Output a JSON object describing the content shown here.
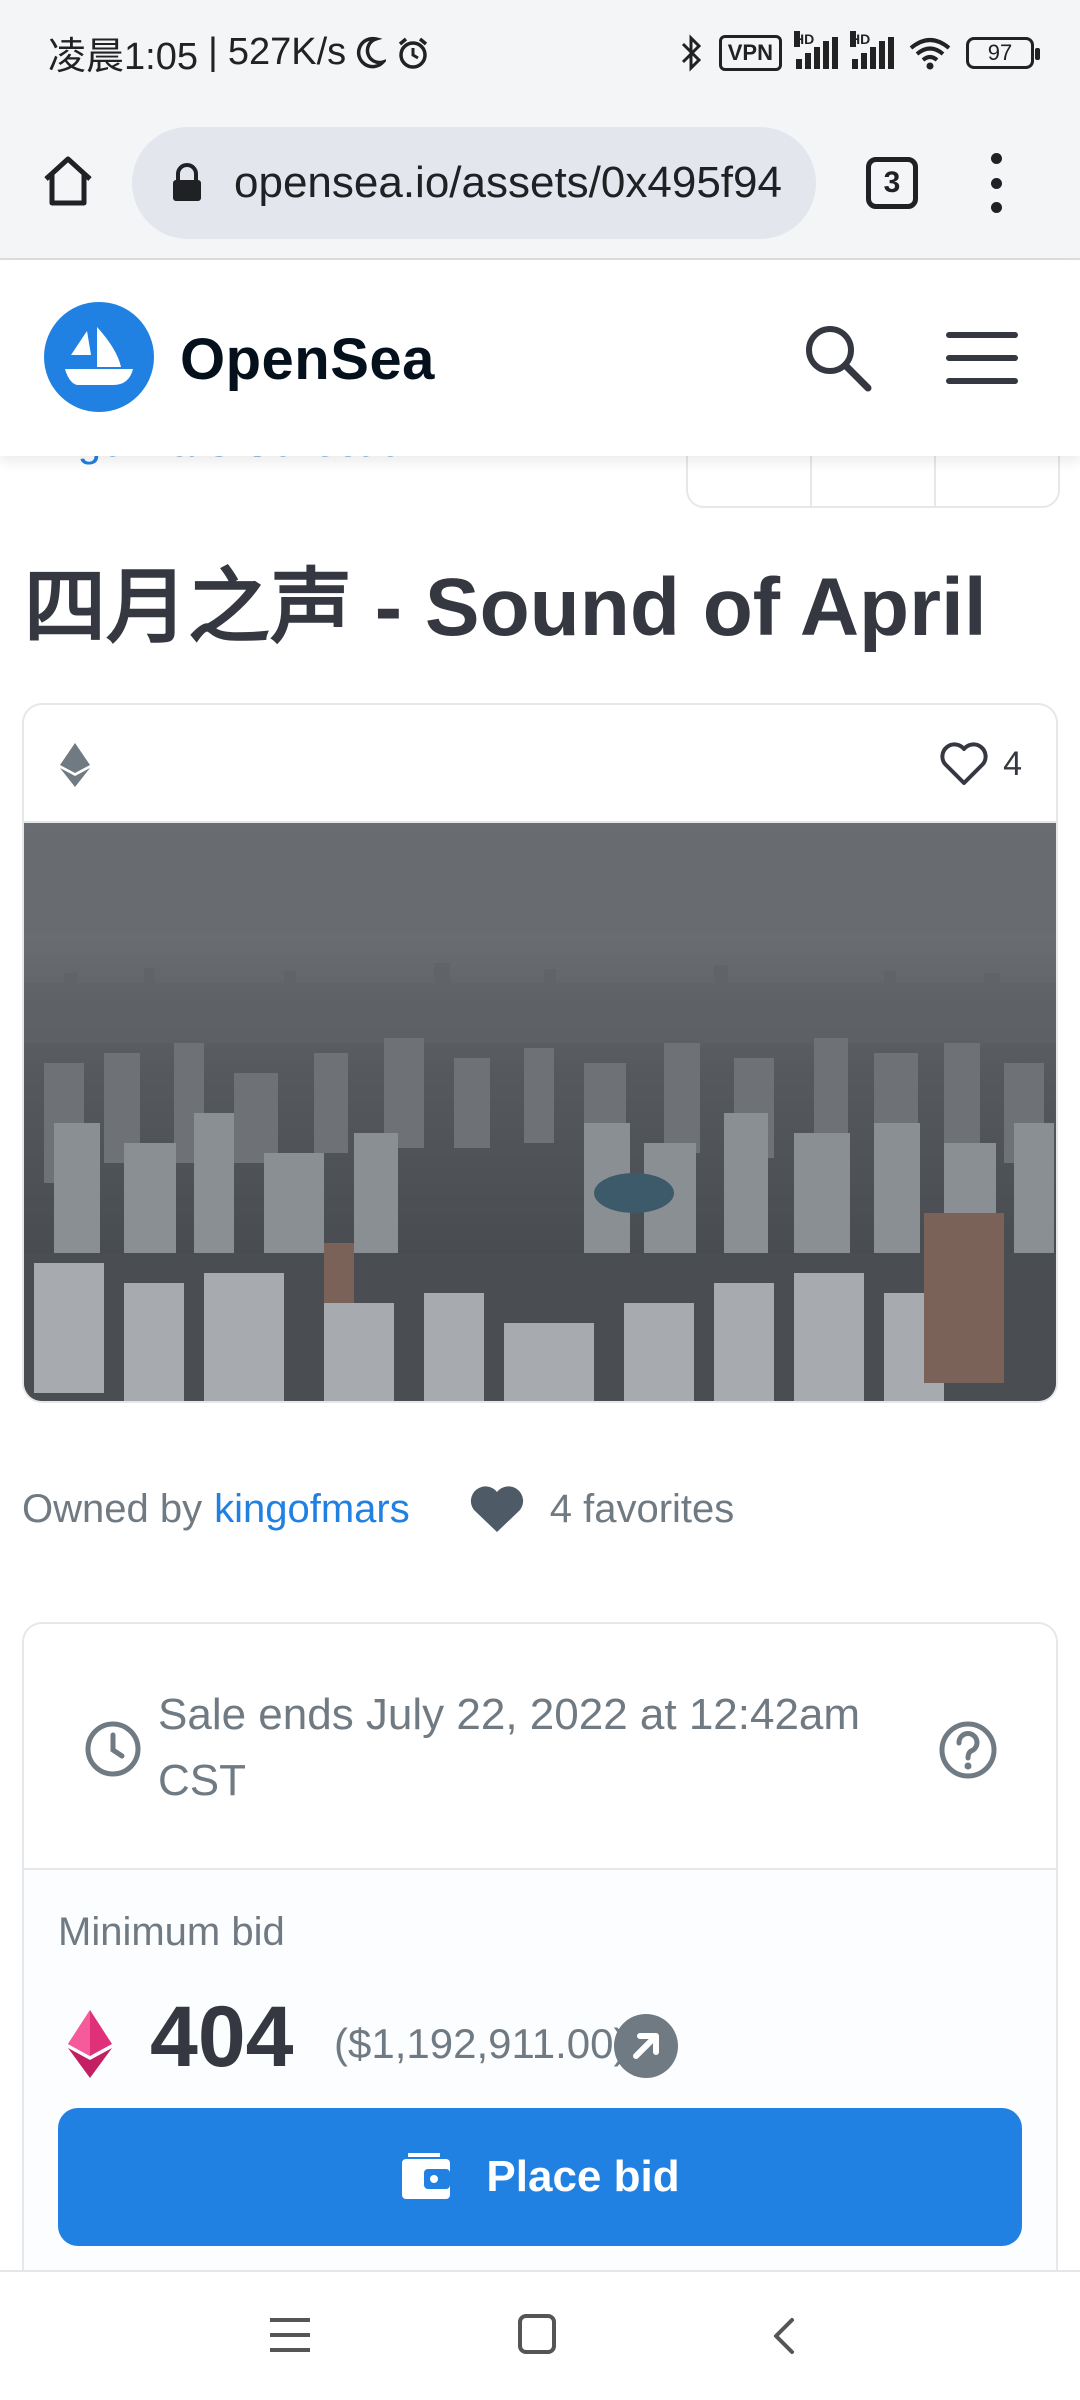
{
  "status_bar": {
    "time": "凌晨1:05",
    "speed": "527K/s",
    "vpn": "VPN",
    "signal_hd": "HD",
    "battery": "97"
  },
  "browser": {
    "url": "opensea.io/assets/0x495f94",
    "tab_count": "3"
  },
  "header": {
    "brand": "OpenSea"
  },
  "asset": {
    "collection_partial": "kingofmars Collection",
    "title": "四月之声 - Sound of April",
    "favorite_count": "4",
    "owned_by_label": "Owned by",
    "owner": "kingofmars",
    "favorites_text": "4 favorites"
  },
  "sale": {
    "ends_text": "Sale ends July 22, 2022 at 12:42am CST",
    "min_bid_label": "Minimum bid",
    "bid_value": "404",
    "bid_usd": "($1,192,911.00)",
    "place_bid_label": "Place bid"
  },
  "colors": {
    "accent": "#2081e2",
    "text_dark": "#353840",
    "text_muted": "#707a83",
    "eth_pink": "#e0307a"
  }
}
